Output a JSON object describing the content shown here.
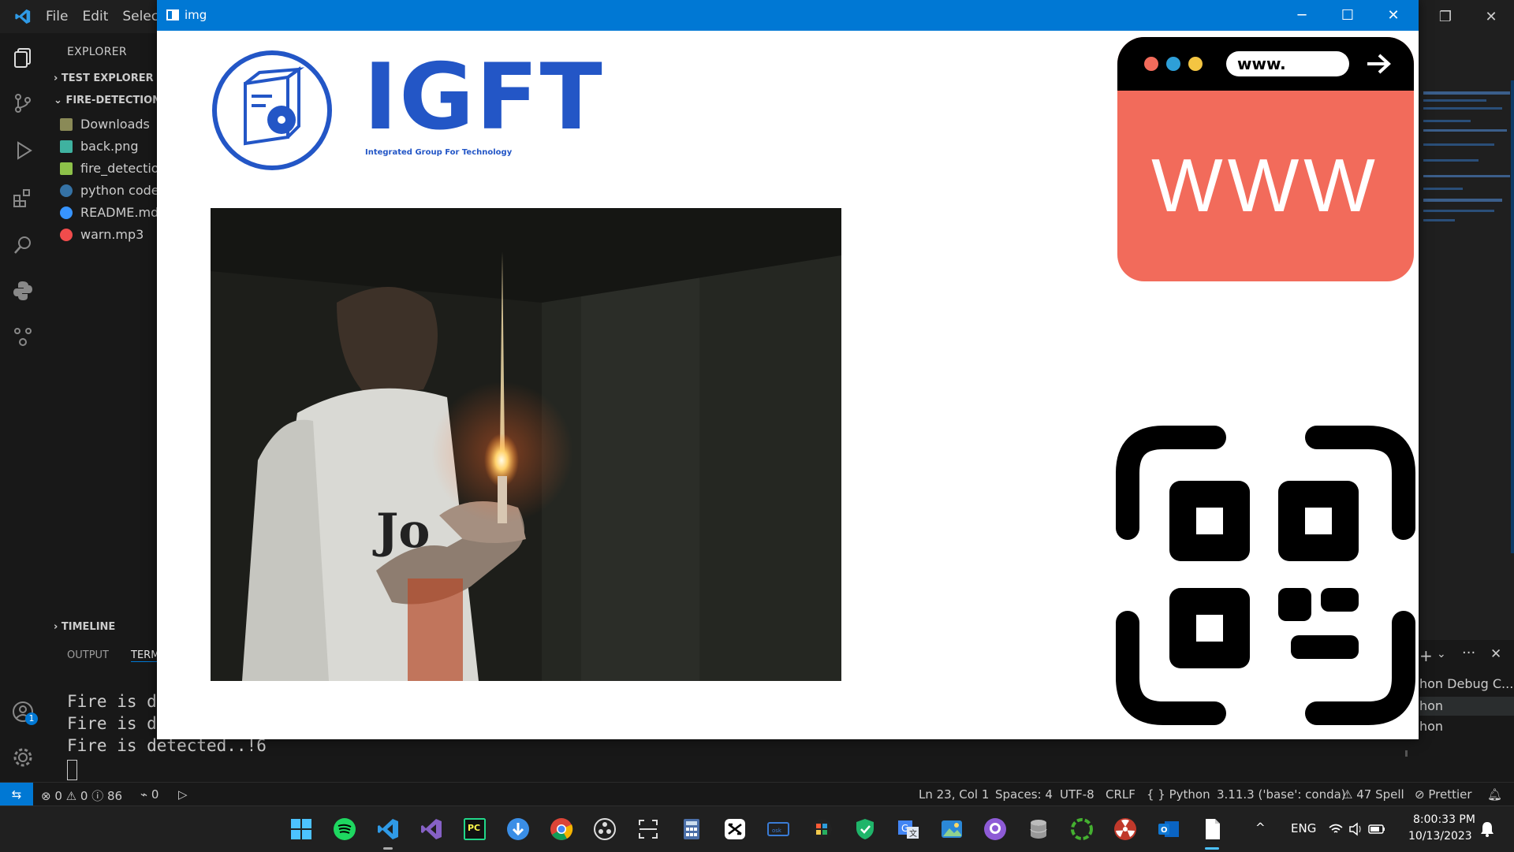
{
  "vscode": {
    "menu": [
      "File",
      "Edit",
      "Selectio"
    ],
    "explorer": {
      "title": "EXPLORER",
      "sections": {
        "test_explorer": "TEST EXPLORER",
        "project": "FIRE-DETECTION-",
        "timeline": "TIMELINE"
      },
      "files": [
        {
          "name": "Downloads",
          "icon": "folder-download-icon",
          "color": "#8a8a57"
        },
        {
          "name": "back.png",
          "icon": "image-file-icon",
          "color": "#3fb2a0"
        },
        {
          "name": "fire_detection",
          "icon": "python-file-icon",
          "color": "#8dc149"
        },
        {
          "name": "python code",
          "icon": "python-file-icon",
          "color": "#3572a5"
        },
        {
          "name": "README.md",
          "icon": "info-file-icon",
          "color": "#3794ff"
        },
        {
          "name": "warn.mp3",
          "icon": "audio-file-icon",
          "color": "#f14c4c"
        }
      ]
    },
    "panel": {
      "tabs": [
        "OUTPUT",
        "TERM"
      ],
      "terminal_lines": [
        "Fire is d",
        "Fire is d",
        "Fire is detected..!6"
      ],
      "sessions": [
        "hon Debug C...",
        "hon",
        "hon"
      ]
    },
    "accounts_badge": "1",
    "statusbar": {
      "errors": "0",
      "warnings": "0",
      "infos": "86",
      "ports": "0",
      "position": "Ln 23, Col 1",
      "spaces": "Spaces: 4",
      "encoding": "UTF-8",
      "eol": "CRLF",
      "language": "Python",
      "interpreter": "3.11.3 ('base': conda)",
      "spell": "47 Spell",
      "prettier": "Prettier"
    }
  },
  "image_window": {
    "title": "img",
    "logo": {
      "name": "IGFT",
      "tagline": "Integrated Group For Technology"
    },
    "www_card": {
      "url": "www.",
      "big_text": "WWW"
    }
  },
  "taskbar": {
    "lang": "ENG",
    "time": "8:00:33 PM",
    "date": "10/13/2023"
  },
  "colors": {
    "accent": "#0078d4",
    "logo_blue": "#2356c6",
    "www_card": "#f26b5b"
  }
}
